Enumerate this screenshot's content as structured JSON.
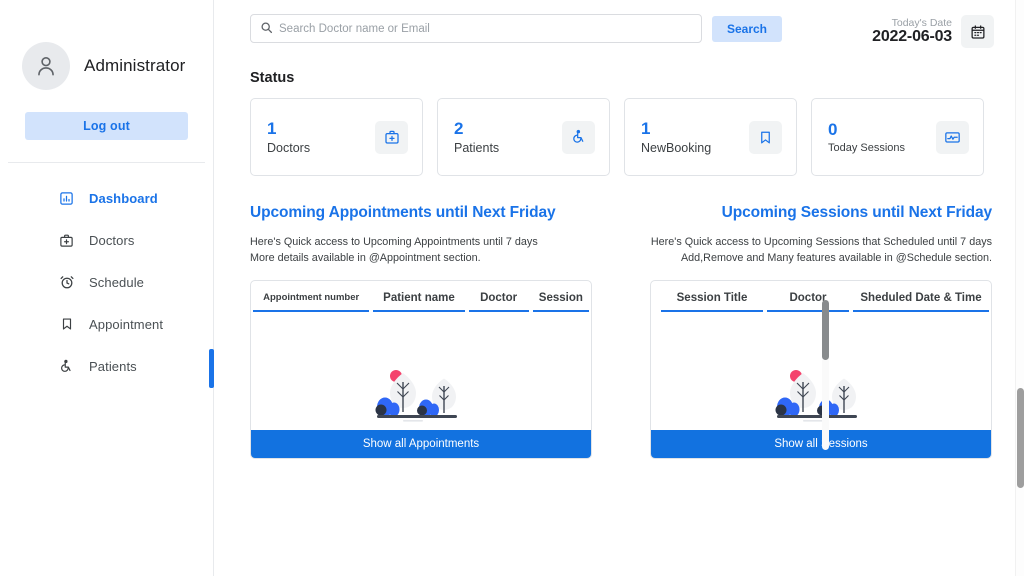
{
  "sidebar": {
    "avatar_icon": "person-icon",
    "profile_name": "Administrator",
    "logout_label": "Log out",
    "items": [
      {
        "label": "Dashboard",
        "icon": "chart-bar-icon",
        "active": true
      },
      {
        "label": "Doctors",
        "icon": "medical-bag-icon",
        "active": false
      },
      {
        "label": "Schedule",
        "icon": "alarm-clock-icon",
        "active": false
      },
      {
        "label": "Appointment",
        "icon": "bookmark-icon",
        "active": false
      },
      {
        "label": "Patients",
        "icon": "wheelchair-icon",
        "active": false
      }
    ]
  },
  "topbar": {
    "search_placeholder": "Search Doctor name or Email",
    "search_value": "",
    "search_icon": "search-icon",
    "search_button": "Search",
    "date_label": "Today's Date",
    "date_value": "2022-06-03",
    "calendar_icon": "calendar-icon"
  },
  "status": {
    "title": "Status",
    "cards": [
      {
        "number": "1",
        "label": "Doctors",
        "icon": "medical-bag-icon"
      },
      {
        "number": "2",
        "label": "Patients",
        "icon": "wheelchair-icon"
      },
      {
        "number": "1",
        "label": "NewBooking",
        "icon": "bookmark-icon"
      },
      {
        "number": "0",
        "label": "Today Sessions",
        "icon": "monitor-activity-icon"
      }
    ]
  },
  "appointments_panel": {
    "title": "Upcoming Appointments until Next Friday",
    "sub_line1": "Here's Quick access to Upcoming Appointments until 7 days",
    "sub_line2": "More details available in @Appointment section.",
    "columns": [
      "Appointment number",
      "Patient name",
      "Doctor",
      "Session"
    ],
    "rows": [],
    "empty_illustration": "empty-landscape-illustration",
    "button_label": "Show all Appointments"
  },
  "sessions_panel": {
    "title": "Upcoming Sessions until Next Friday",
    "sub_line1": "Here's Quick access to Upcoming Sessions that Scheduled until 7 days",
    "sub_line2": "Add,Remove and Many features available in @Schedule section.",
    "columns": [
      "Session Title",
      "Doctor",
      "Sheduled Date & Time"
    ],
    "rows": [],
    "empty_illustration": "empty-landscape-illustration",
    "button_label": "Show all Sessions"
  },
  "colors": {
    "accent": "#1a73e8",
    "button": "#1272e0",
    "accent_soft": "#d2e3fc",
    "border": "#e0e3e7",
    "text": "#202124",
    "muted": "#9aa0a6"
  }
}
